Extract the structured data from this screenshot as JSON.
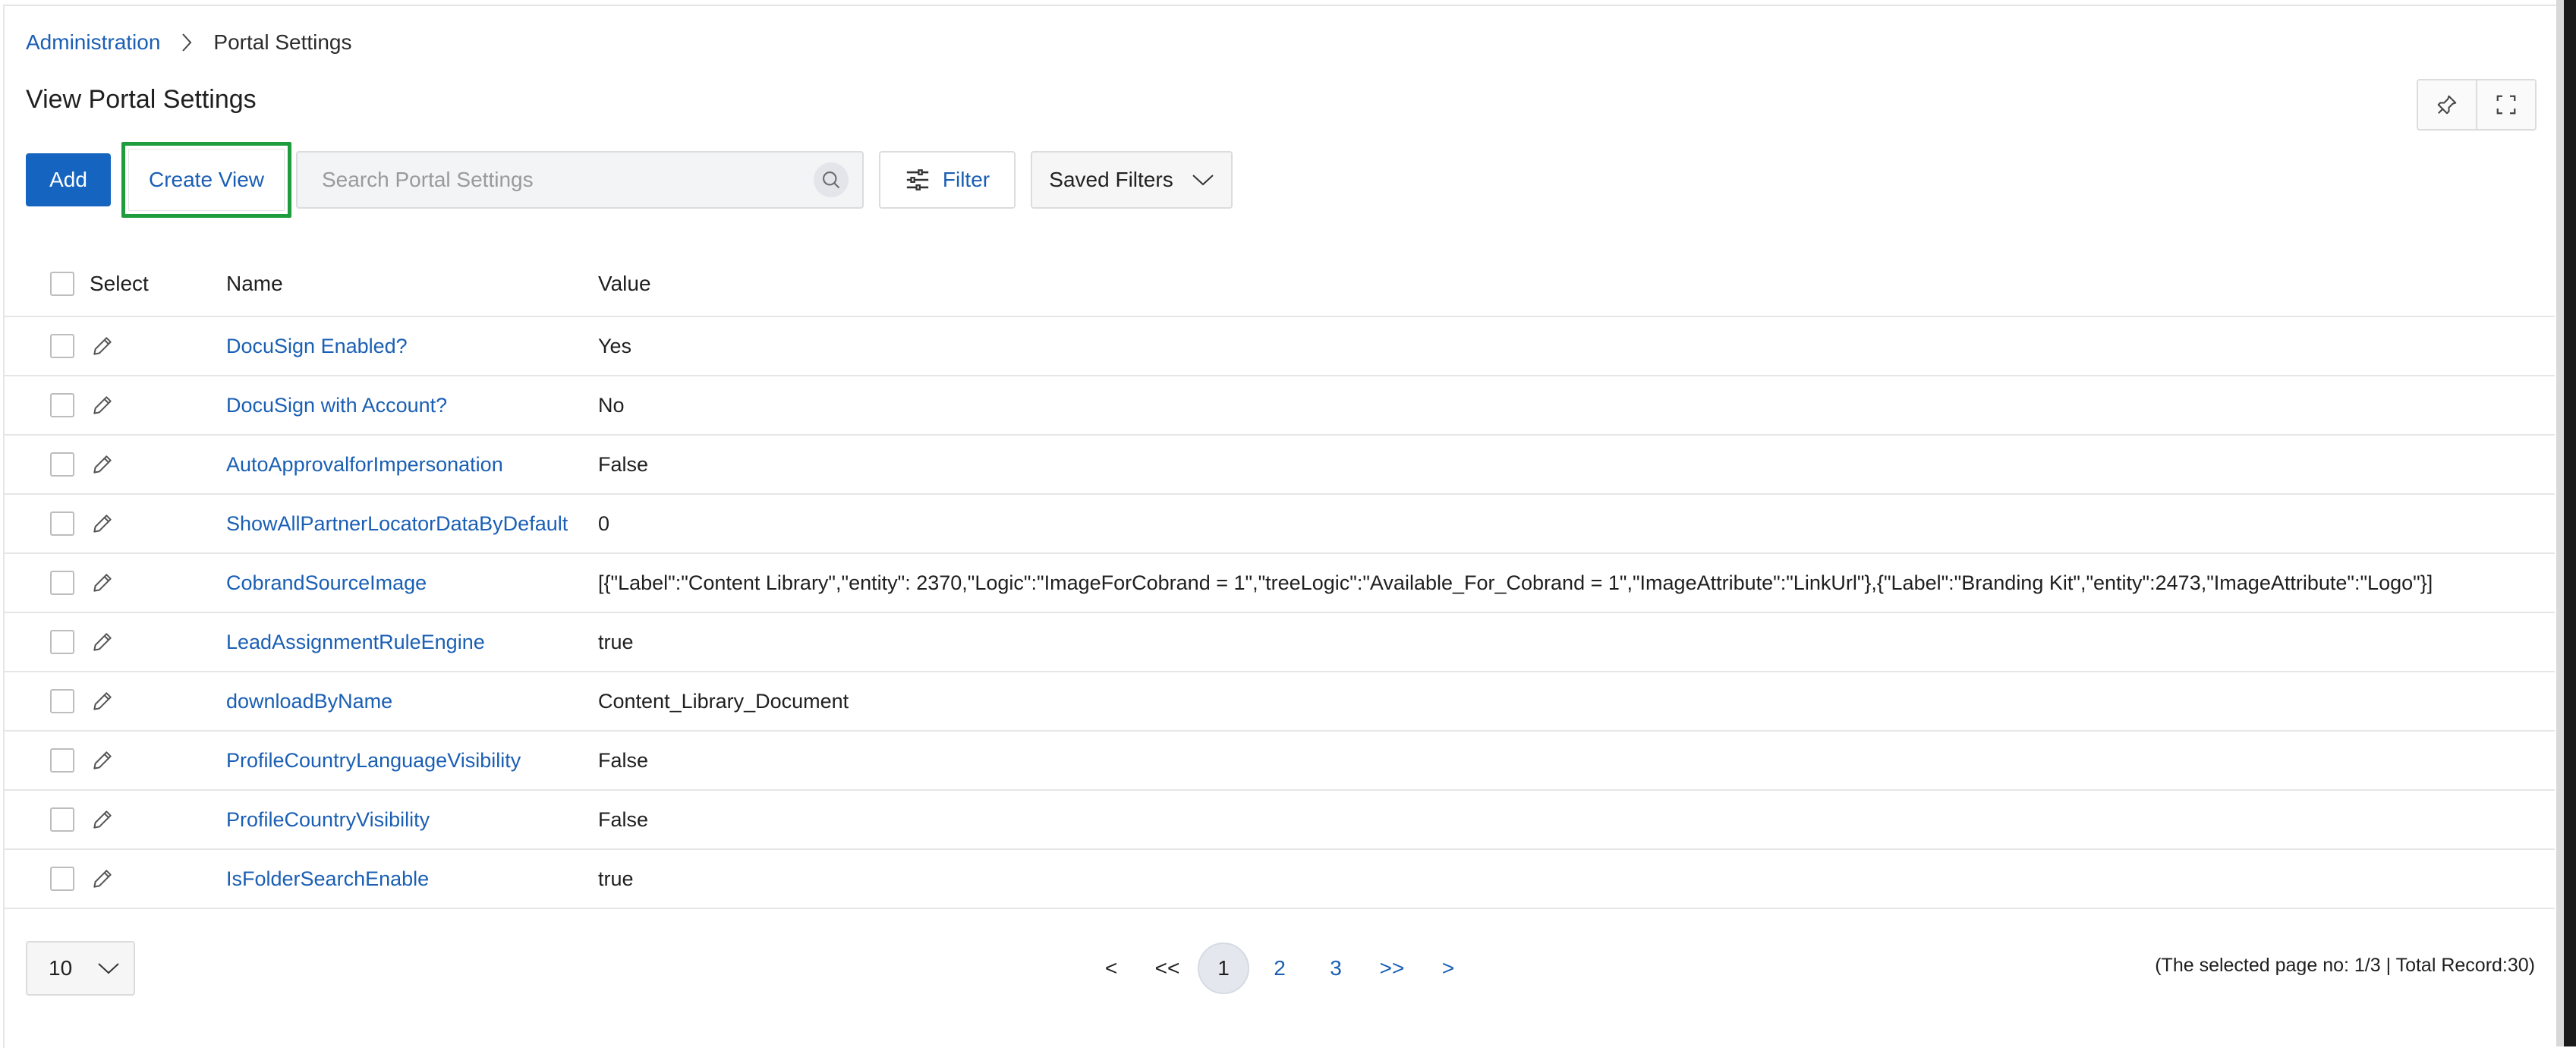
{
  "breadcrumb": {
    "root": "Administration",
    "current": "Portal Settings"
  },
  "page": {
    "title": "View Portal Settings"
  },
  "toolbar": {
    "add_label": "Add",
    "create_view_label": "Create View",
    "search_placeholder": "Search Portal Settings",
    "filter_label": "Filter",
    "saved_filters_label": "Saved Filters"
  },
  "table": {
    "headers": {
      "select": "Select",
      "name": "Name",
      "value": "Value"
    },
    "rows": [
      {
        "name": "DocuSign Enabled?",
        "value": "Yes"
      },
      {
        "name": "DocuSign with Account?",
        "value": "No"
      },
      {
        "name": "AutoApprovalforImpersonation",
        "value": "False"
      },
      {
        "name": "ShowAllPartnerLocatorDataByDefault",
        "value": "0"
      },
      {
        "name": "CobrandSourceImage",
        "value": "[{\"Label\":\"Content Library\",\"entity\": 2370,\"Logic\":\"ImageForCobrand = 1\",\"treeLogic\":\"Available_For_Cobrand = 1\",\"ImageAttribute\":\"LinkUrl\"},{\"Label\":\"Branding Kit\",\"entity\":2473,\"ImageAttribute\":\"Logo\"}]"
      },
      {
        "name": "LeadAssignmentRuleEngine",
        "value": "true"
      },
      {
        "name": "downloadByName",
        "value": "Content_Library_Document"
      },
      {
        "name": "ProfileCountryLanguageVisibility",
        "value": "False"
      },
      {
        "name": "ProfileCountryVisibility",
        "value": "False"
      },
      {
        "name": "IsFolderSearchEnable",
        "value": "true"
      }
    ]
  },
  "pagination": {
    "page_size": "10",
    "prev": "<",
    "first": "<<",
    "pages": [
      "1",
      "2",
      "3"
    ],
    "last": ">>",
    "next": ">",
    "info": "(The selected page no: 1/3 | Total Record:30)"
  },
  "colors": {
    "link": "#1a5fb4",
    "primary_button": "#1565c0",
    "highlight_border": "#1f9d3e"
  }
}
